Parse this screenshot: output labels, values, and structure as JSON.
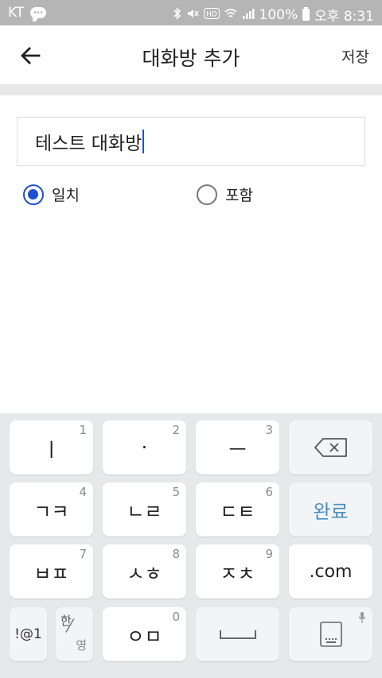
{
  "status_bar": {
    "carrier": "KT",
    "battery_text": "100%",
    "time": "오후 8:31",
    "icons": [
      "chat-icon",
      "bluetooth-icon",
      "mute-icon",
      "hd-icon",
      "wifi-icon",
      "signal-icon",
      "battery-icon"
    ]
  },
  "toolbar": {
    "title": "대화방 추가",
    "save_label": "저장",
    "back_icon": "arrow-left-icon"
  },
  "form": {
    "room_name_value": "테스트 대화방",
    "options": [
      {
        "label": "일치",
        "checked": true
      },
      {
        "label": "포함",
        "checked": false
      }
    ],
    "accent_color": "#1f4fd1"
  },
  "keyboard": {
    "rows": [
      [
        {
          "label": "ㅣ",
          "num": "1"
        },
        {
          "label": "·",
          "num": "2"
        },
        {
          "label": "ㅡ",
          "num": "3"
        },
        {
          "label": "",
          "icon": "backspace-icon"
        }
      ],
      [
        {
          "label": "ㄱㅋ",
          "num": "4"
        },
        {
          "label": "ㄴㄹ",
          "num": "5"
        },
        {
          "label": "ㄷㅌ",
          "num": "6"
        },
        {
          "label": "완료"
        }
      ],
      [
        {
          "label": "ㅂㅍ",
          "num": "7"
        },
        {
          "label": "ㅅㅎ",
          "num": "8"
        },
        {
          "label": "ㅈㅊ",
          "num": "9"
        },
        {
          "label": ".com"
        }
      ],
      [
        {
          "label": "!@1"
        },
        {
          "label_top": "한",
          "label_bottom": "영"
        },
        {
          "label": "ㅇㅁ",
          "num": "0"
        },
        {
          "label": "",
          "icon": "space-icon"
        },
        {
          "label": "",
          "icon": "keyboard-hide-icon"
        }
      ]
    ],
    "done_color": "#4a8fc2"
  }
}
